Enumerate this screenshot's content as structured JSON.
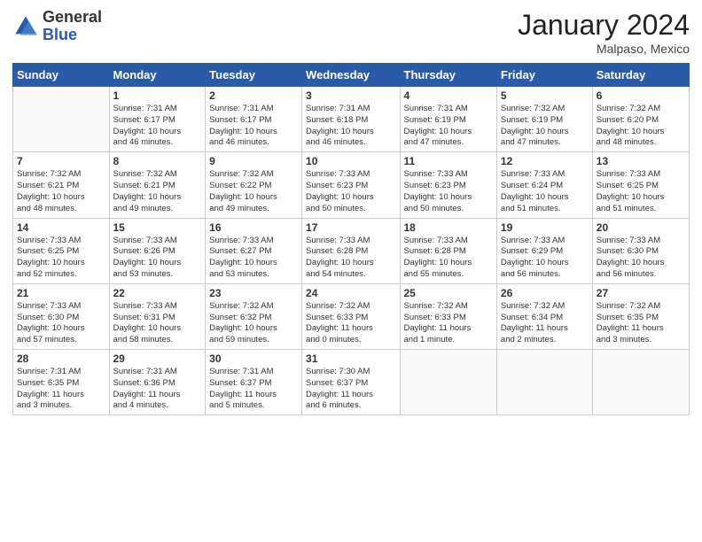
{
  "header": {
    "logo_general": "General",
    "logo_blue": "Blue",
    "month_year": "January 2024",
    "location": "Malpaso, Mexico"
  },
  "days_of_week": [
    "Sunday",
    "Monday",
    "Tuesday",
    "Wednesday",
    "Thursday",
    "Friday",
    "Saturday"
  ],
  "weeks": [
    [
      {
        "day": "",
        "info": ""
      },
      {
        "day": "1",
        "info": "Sunrise: 7:31 AM\nSunset: 6:17 PM\nDaylight: 10 hours\nand 46 minutes."
      },
      {
        "day": "2",
        "info": "Sunrise: 7:31 AM\nSunset: 6:17 PM\nDaylight: 10 hours\nand 46 minutes."
      },
      {
        "day": "3",
        "info": "Sunrise: 7:31 AM\nSunset: 6:18 PM\nDaylight: 10 hours\nand 46 minutes."
      },
      {
        "day": "4",
        "info": "Sunrise: 7:31 AM\nSunset: 6:19 PM\nDaylight: 10 hours\nand 47 minutes."
      },
      {
        "day": "5",
        "info": "Sunrise: 7:32 AM\nSunset: 6:19 PM\nDaylight: 10 hours\nand 47 minutes."
      },
      {
        "day": "6",
        "info": "Sunrise: 7:32 AM\nSunset: 6:20 PM\nDaylight: 10 hours\nand 48 minutes."
      }
    ],
    [
      {
        "day": "7",
        "info": "Sunrise: 7:32 AM\nSunset: 6:21 PM\nDaylight: 10 hours\nand 48 minutes."
      },
      {
        "day": "8",
        "info": "Sunrise: 7:32 AM\nSunset: 6:21 PM\nDaylight: 10 hours\nand 49 minutes."
      },
      {
        "day": "9",
        "info": "Sunrise: 7:32 AM\nSunset: 6:22 PM\nDaylight: 10 hours\nand 49 minutes."
      },
      {
        "day": "10",
        "info": "Sunrise: 7:33 AM\nSunset: 6:23 PM\nDaylight: 10 hours\nand 50 minutes."
      },
      {
        "day": "11",
        "info": "Sunrise: 7:33 AM\nSunset: 6:23 PM\nDaylight: 10 hours\nand 50 minutes."
      },
      {
        "day": "12",
        "info": "Sunrise: 7:33 AM\nSunset: 6:24 PM\nDaylight: 10 hours\nand 51 minutes."
      },
      {
        "day": "13",
        "info": "Sunrise: 7:33 AM\nSunset: 6:25 PM\nDaylight: 10 hours\nand 51 minutes."
      }
    ],
    [
      {
        "day": "14",
        "info": "Sunrise: 7:33 AM\nSunset: 6:25 PM\nDaylight: 10 hours\nand 52 minutes."
      },
      {
        "day": "15",
        "info": "Sunrise: 7:33 AM\nSunset: 6:26 PM\nDaylight: 10 hours\nand 53 minutes."
      },
      {
        "day": "16",
        "info": "Sunrise: 7:33 AM\nSunset: 6:27 PM\nDaylight: 10 hours\nand 53 minutes."
      },
      {
        "day": "17",
        "info": "Sunrise: 7:33 AM\nSunset: 6:28 PM\nDaylight: 10 hours\nand 54 minutes."
      },
      {
        "day": "18",
        "info": "Sunrise: 7:33 AM\nSunset: 6:28 PM\nDaylight: 10 hours\nand 55 minutes."
      },
      {
        "day": "19",
        "info": "Sunrise: 7:33 AM\nSunset: 6:29 PM\nDaylight: 10 hours\nand 56 minutes."
      },
      {
        "day": "20",
        "info": "Sunrise: 7:33 AM\nSunset: 6:30 PM\nDaylight: 10 hours\nand 56 minutes."
      }
    ],
    [
      {
        "day": "21",
        "info": "Sunrise: 7:33 AM\nSunset: 6:30 PM\nDaylight: 10 hours\nand 57 minutes."
      },
      {
        "day": "22",
        "info": "Sunrise: 7:33 AM\nSunset: 6:31 PM\nDaylight: 10 hours\nand 58 minutes."
      },
      {
        "day": "23",
        "info": "Sunrise: 7:32 AM\nSunset: 6:32 PM\nDaylight: 10 hours\nand 59 minutes."
      },
      {
        "day": "24",
        "info": "Sunrise: 7:32 AM\nSunset: 6:33 PM\nDaylight: 11 hours\nand 0 minutes."
      },
      {
        "day": "25",
        "info": "Sunrise: 7:32 AM\nSunset: 6:33 PM\nDaylight: 11 hours\nand 1 minute."
      },
      {
        "day": "26",
        "info": "Sunrise: 7:32 AM\nSunset: 6:34 PM\nDaylight: 11 hours\nand 2 minutes."
      },
      {
        "day": "27",
        "info": "Sunrise: 7:32 AM\nSunset: 6:35 PM\nDaylight: 11 hours\nand 3 minutes."
      }
    ],
    [
      {
        "day": "28",
        "info": "Sunrise: 7:31 AM\nSunset: 6:35 PM\nDaylight: 11 hours\nand 3 minutes."
      },
      {
        "day": "29",
        "info": "Sunrise: 7:31 AM\nSunset: 6:36 PM\nDaylight: 11 hours\nand 4 minutes."
      },
      {
        "day": "30",
        "info": "Sunrise: 7:31 AM\nSunset: 6:37 PM\nDaylight: 11 hours\nand 5 minutes."
      },
      {
        "day": "31",
        "info": "Sunrise: 7:30 AM\nSunset: 6:37 PM\nDaylight: 11 hours\nand 6 minutes."
      },
      {
        "day": "",
        "info": ""
      },
      {
        "day": "",
        "info": ""
      },
      {
        "day": "",
        "info": ""
      }
    ]
  ]
}
